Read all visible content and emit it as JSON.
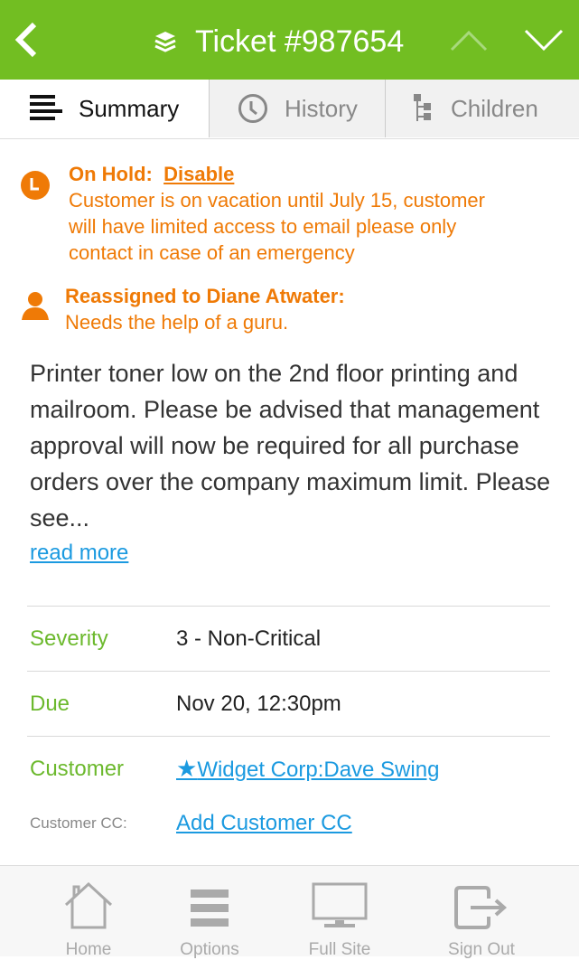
{
  "header": {
    "title": "Ticket #987654",
    "icons": {
      "back": "chevron-left-icon",
      "ticket": "layers-icon",
      "prev": "chevron-up-icon",
      "next": "chevron-down-icon"
    },
    "colors": {
      "background": "#72be22",
      "prev_disabled": "#a8d97c"
    }
  },
  "tabs": [
    {
      "label": "Summary",
      "icon": "list-icon",
      "active": true
    },
    {
      "label": "History",
      "icon": "clock-icon",
      "active": false
    },
    {
      "label": "Children",
      "icon": "tree-icon",
      "active": false
    }
  ],
  "notices": {
    "hold": {
      "title": "On Hold:",
      "action": "Disable",
      "message": "Customer is on vacation until July 15, customer will have limited access to email please only contact in case of an emergency",
      "lines": [
        "Customer is on vacation until July 15, customer",
        "will have limited access to email please only",
        "contact in case of an emergency"
      ]
    },
    "reassign": {
      "title": "Reassigned to Diane Atwater:",
      "message": "Needs the help of a guru."
    },
    "color": "#ef7a06"
  },
  "description": {
    "text": "Printer toner low on the 2nd floor printing and mailroom. Please be advised that management approval will now be required for all purchase orders over the company maximum limit. Please see...",
    "read_more": "read more"
  },
  "fields": {
    "severity": {
      "label": "Severity",
      "value": "3 - Non-Critical"
    },
    "due": {
      "label": "Due",
      "value": "Nov 20, 12:30pm"
    },
    "customer": {
      "label": "Customer",
      "value": "Widget Corp:Dave Swing",
      "icon": "star-icon"
    },
    "customer_cc": {
      "label": "Customer CC:",
      "value": "Add Customer CC"
    }
  },
  "footer": {
    "items": [
      {
        "label": "Home",
        "icon": "home-icon"
      },
      {
        "label": "Options",
        "icon": "menu-icon"
      },
      {
        "label": "Full Site",
        "icon": "monitor-icon"
      },
      {
        "label": "Sign Out",
        "icon": "sign-out-icon"
      }
    ]
  }
}
